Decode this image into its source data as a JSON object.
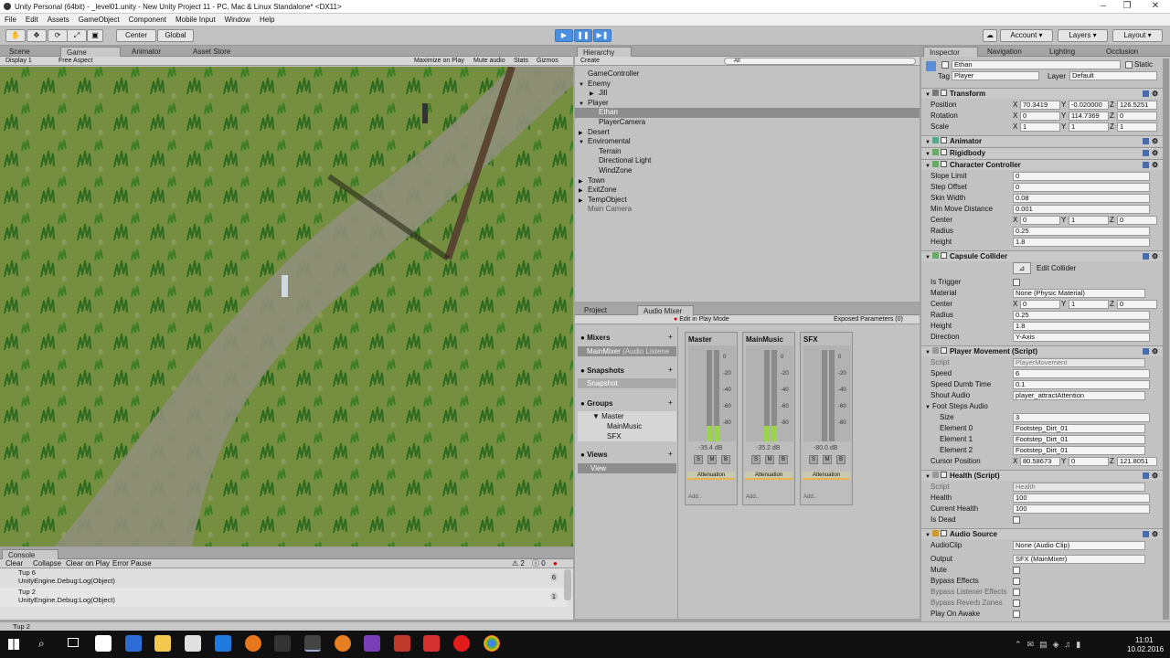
{
  "title_bar": {
    "text": "Unity Personal (64bit) - _level01.unity - New Unity Project 11 - PC, Mac & Linux Standalone* <DX11>"
  },
  "menu": [
    "File",
    "Edit",
    "Assets",
    "GameObject",
    "Component",
    "Mobile Input",
    "Window",
    "Help"
  ],
  "toolbar": {
    "center_label": "Center",
    "global_label": "Global",
    "account_label": "Account",
    "layers_label": "Layers",
    "layout_label": "Layout"
  },
  "scene_tabs": {
    "scene": "Scene",
    "game": "Game",
    "animator": "Animator",
    "asset_store": "Asset Store"
  },
  "game_bar": {
    "display": "Display 1",
    "aspect": "Free Aspect",
    "maximize": "Maximize on Play",
    "mute": "Mute audio",
    "stats": "Stats",
    "gizmos": "Gizmos"
  },
  "hierarchy": {
    "tab": "Hierarchy",
    "create": "Create",
    "search_placeholder": "All",
    "items": [
      {
        "label": "GameController",
        "indent": 0,
        "arrow": ""
      },
      {
        "label": "Enemy",
        "indent": 0,
        "arrow": "▼"
      },
      {
        "label": "Jill",
        "indent": 1,
        "arrow": "▶"
      },
      {
        "label": "Player",
        "indent": 0,
        "arrow": "▼"
      },
      {
        "label": "Ethan",
        "indent": 1,
        "arrow": "",
        "selected": true
      },
      {
        "label": "PlayerCamera",
        "indent": 1,
        "arrow": ""
      },
      {
        "label": "Desert",
        "indent": 0,
        "arrow": "▶"
      },
      {
        "label": "Enviromental",
        "indent": 0,
        "arrow": "▼"
      },
      {
        "label": "Terrain",
        "indent": 1,
        "arrow": ""
      },
      {
        "label": "Directional Light",
        "indent": 1,
        "arrow": ""
      },
      {
        "label": "WindZone",
        "indent": 1,
        "arrow": ""
      },
      {
        "label": "Town",
        "indent": 0,
        "arrow": "▶"
      },
      {
        "label": "ExitZone",
        "indent": 0,
        "arrow": "▶"
      },
      {
        "label": "TempObject",
        "indent": 0,
        "arrow": "▶"
      },
      {
        "label": "Main Camera",
        "indent": 0,
        "arrow": "",
        "dim": true
      }
    ]
  },
  "audio_mixer": {
    "project_tab": "Project",
    "mixer_tab": "Audio Mixer",
    "edit_in_play": "Edit in Play Mode",
    "exposed": "Exposed Parameters (0)",
    "mixers_header": "Mixers",
    "mixer_item": "MainMixer",
    "mixer_item_sub": "(Audio Listene",
    "snapshots_header": "Snapshots",
    "snapshot_item": "Snapshot",
    "groups_header": "Groups",
    "groups": [
      "Master",
      "MainMusic",
      "SFX"
    ],
    "views_header": "Views",
    "view_item": "View",
    "strips": [
      {
        "name": "Master",
        "db": "-35.4 dB",
        "fill": 0.17,
        "attenuation": "Attenuation",
        "add": "Add..",
        "s": "S",
        "m": "M",
        "b": "B"
      },
      {
        "name": "MainMusic",
        "db": "-35.2 dB",
        "fill": 0.17,
        "attenuation": "Attenuation",
        "add": "Add..",
        "s": "S",
        "m": "M",
        "b": "B"
      },
      {
        "name": "SFX",
        "db": "-80.0 dB",
        "fill": 0.0,
        "attenuation": "Attenuation",
        "add": "Add..",
        "s": "S",
        "m": "M",
        "b": "B"
      }
    ],
    "scale": [
      "0",
      "-20",
      "-40",
      "-60",
      "-80"
    ]
  },
  "console": {
    "tab": "Console",
    "clear": "Clear",
    "collapse": "Collapse",
    "clear_on_play": "Clear on Play",
    "error_pause": "Error Pause",
    "warn_count": "2",
    "error_count": "0",
    "entries": [
      {
        "line1": "Tup 6",
        "line2": "UnityEngine.Debug:Log(Object)",
        "count": "6"
      },
      {
        "line1": "Tup 2",
        "line2": "UnityEngine.Debug:Log(Object)",
        "count": "1"
      }
    ],
    "status": "Tup 2"
  },
  "inspector": {
    "tabs": {
      "inspector": "Inspector",
      "navigation": "Navigation",
      "lighting": "Lighting",
      "occlusion": "Occlusion"
    },
    "object_name": "Ethan",
    "static_label": "Static",
    "tag_label": "Tag",
    "tag_value": "Player",
    "layer_label": "Layer",
    "layer_value": "Default",
    "transform": {
      "title": "Transform",
      "position": {
        "label": "Position",
        "x": "70.3419",
        "y": "-0.020000",
        "z": "126.5251"
      },
      "rotation": {
        "label": "Rotation",
        "x": "0",
        "y": "114.7369",
        "z": "0"
      },
      "scale": {
        "label": "Scale",
        "x": "1",
        "y": "1",
        "z": "1"
      }
    },
    "animator_title": "Animator",
    "rigidbody_title": "Rigidbody",
    "character_controller": {
      "title": "Character Controller",
      "rows": [
        [
          "Slope Limit",
          "0"
        ],
        [
          "Step Offset",
          "0"
        ],
        [
          "Skin Width",
          "0.08"
        ],
        [
          "Min Move Distance",
          "0.001"
        ]
      ],
      "center": {
        "label": "Center",
        "x": "0",
        "y": "1",
        "z": "0"
      },
      "radius": [
        "Radius",
        "0.25"
      ],
      "height": [
        "Height",
        "1.8"
      ]
    },
    "capsule": {
      "title": "Capsule Collider",
      "edit": "Edit Collider",
      "is_trigger": "Is Trigger",
      "material": [
        "Material",
        "None (Physic Material)"
      ],
      "center": {
        "label": "Center",
        "x": "0",
        "y": "1",
        "z": "0"
      },
      "radius": [
        "Radius",
        "0.25"
      ],
      "height": [
        "Height",
        "1.8"
      ],
      "direction": [
        "Direction",
        "Y-Axis"
      ]
    },
    "player_movement": {
      "title": "Player Movement (Script)",
      "script": [
        "Script",
        "PlayerMovement"
      ],
      "speed": [
        "Speed",
        "6"
      ],
      "dumb": [
        "Speed Dumb Time",
        "0.1"
      ],
      "shout": [
        "Shout Audio",
        "player_attractAttention"
      ],
      "foot": "Foot Steps Audio",
      "size": [
        "Size",
        "3"
      ],
      "elements": [
        [
          "Element 0",
          "Footstep_Dirt_01"
        ],
        [
          "Element 1",
          "Footstep_Dirt_01"
        ],
        [
          "Element 2",
          "Footstep_Dirt_01"
        ]
      ],
      "cursor": {
        "label": "Cursor Position",
        "x": "80.58673",
        "y": "0",
        "z": "121.8051"
      }
    },
    "health": {
      "title": "Health (Script)",
      "script": [
        "Script",
        "Health"
      ],
      "health": [
        "Health",
        "100"
      ],
      "current": [
        "Current Health",
        "100"
      ],
      "dead": "Is Dead"
    },
    "audio_source": {
      "title": "Audio Source",
      "clip": [
        "AudioClip",
        "None (Audio Clip)"
      ],
      "output": [
        "Output",
        "SFX (MainMixer)"
      ],
      "flags": [
        "Mute",
        "Bypass Effects",
        "Bypass Listener Effects",
        "Bypass Reverb Zones",
        "Play On Awake"
      ]
    }
  },
  "taskbar": {
    "time": "11:01",
    "date": "10.02.2016"
  }
}
